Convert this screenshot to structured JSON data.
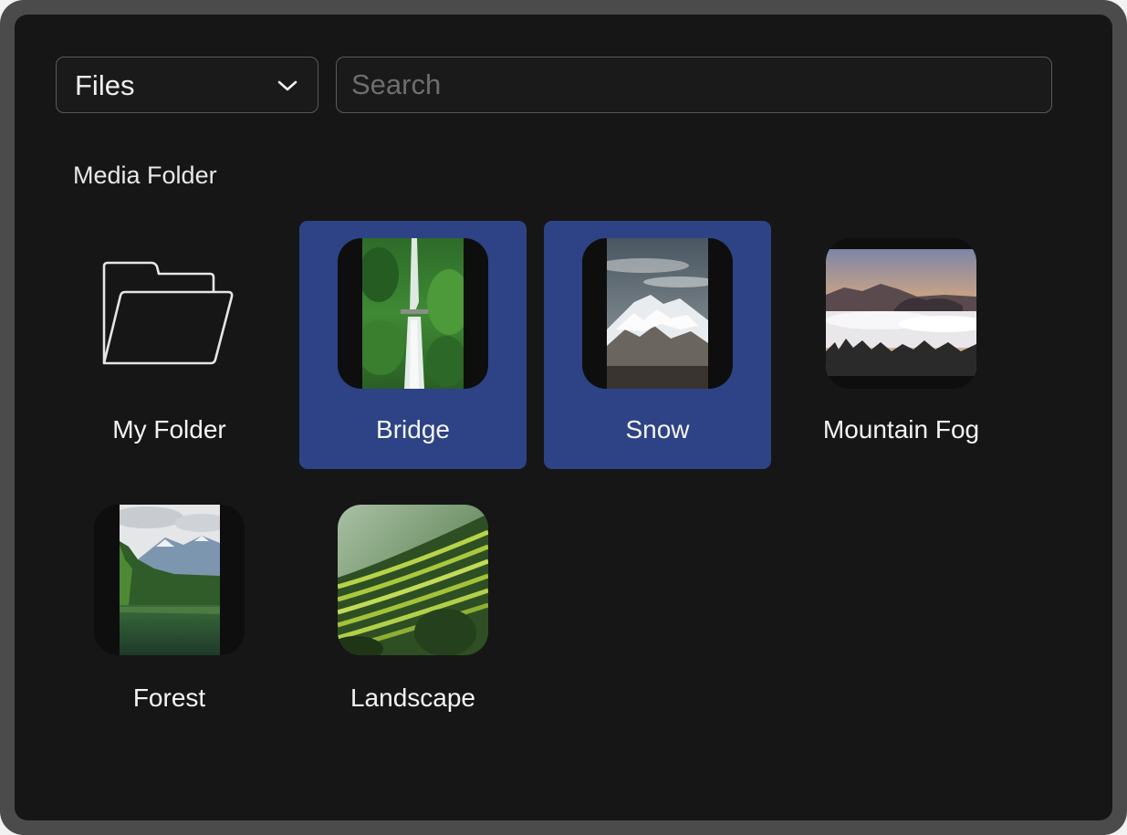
{
  "toolbar": {
    "dropdown_value": "Files",
    "search_placeholder": "Search"
  },
  "section": {
    "title": "Media Folder"
  },
  "items": [
    {
      "label": "My Folder",
      "type": "folder",
      "selected": false,
      "icon": "folder-icon"
    },
    {
      "label": "Bridge",
      "type": "image",
      "selected": true,
      "icon": "waterfall-thumbnail"
    },
    {
      "label": "Snow",
      "type": "image",
      "selected": true,
      "icon": "snowy-mountain-thumbnail"
    },
    {
      "label": "Mountain Fog",
      "type": "image",
      "selected": false,
      "icon": "foggy-mountain-thumbnail"
    },
    {
      "label": "Forest",
      "type": "image",
      "selected": false,
      "icon": "forest-lake-thumbnail"
    },
    {
      "label": "Landscape",
      "type": "image",
      "selected": false,
      "icon": "rice-terrace-thumbnail"
    }
  ],
  "colors": {
    "selection": "#2d4385",
    "panel_background": "#161616",
    "frame": "#4b4b4b"
  }
}
